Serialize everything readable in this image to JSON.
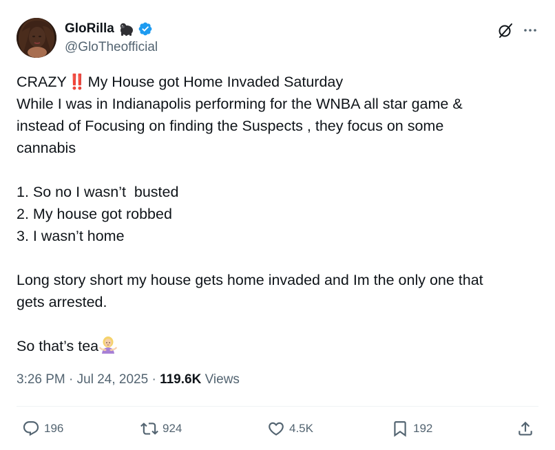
{
  "author": {
    "display_name": "GloRilla",
    "handle": "@GloTheofficial",
    "name_icon": "gorilla-emoji",
    "verified": true,
    "colors": {
      "verified_blue": "#1d9bf0"
    }
  },
  "tweet": {
    "line1_before": "CRAZY",
    "line1_emoji": "‼️",
    "line1_after": "My House got Home Invaded Saturday",
    "line2": "While I was in Indianapolis performing for the WNBA all star game &",
    "line3": "instead of Focusing on finding the Suspects , they focus on some",
    "line4": "cannabis",
    "list_1": "1. So no I wasn’t  busted",
    "list_2": "2. My house got robbed",
    "list_3": "3. I wasn’t home",
    "para3_line1": "Long story short my house gets home invaded and Im the only one that",
    "para3_line2": "gets arrested.",
    "closing": "So that’s tea",
    "closing_emoji": "woman-shrugging-emoji"
  },
  "meta": {
    "time": "3:26 PM",
    "separator": "·",
    "date": "Jul 24, 2025",
    "views_count": "119.6K",
    "views_label": "Views"
  },
  "actions": {
    "replies": "196",
    "reposts": "924",
    "likes": "4.5K",
    "bookmarks": "192"
  },
  "icons": {
    "header_right": [
      "grok-icon",
      "more-icon"
    ],
    "action_bar": [
      "reply-icon",
      "repost-icon",
      "like-icon",
      "bookmark-icon",
      "share-icon"
    ]
  }
}
